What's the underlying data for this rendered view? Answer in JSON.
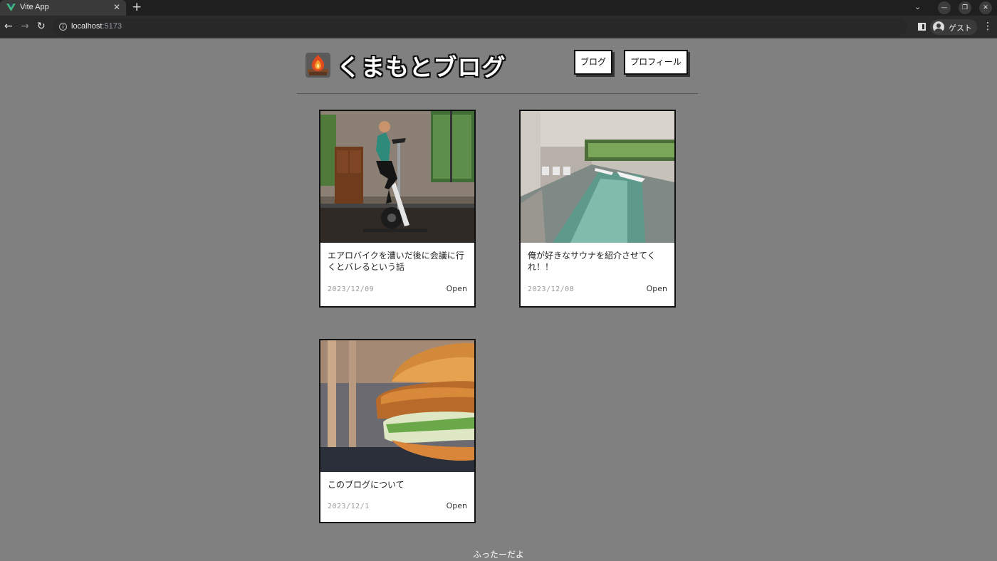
{
  "browser": {
    "tab_title": "Vite App",
    "url_host": "localhost",
    "url_port": ":5173",
    "profile_name": "ゲスト"
  },
  "site": {
    "title": "くまもとブログ",
    "nav": [
      {
        "label": "ブログ"
      },
      {
        "label": "プロフィール"
      }
    ]
  },
  "posts": [
    {
      "title": "エアロバイクを漕いだ後に会議に行くとバレるという話",
      "date": "2023/12/09",
      "open_label": "Open",
      "image": "exercise-bike-photo"
    },
    {
      "title": "俺が好きなサウナを紹介させてくれ！！",
      "date": "2023/12/08",
      "open_label": "Open",
      "image": "indoor-pool-photo"
    },
    {
      "title": "このブログについて",
      "date": "2023/12/1",
      "open_label": "Open",
      "image": "chicken-burger-photo"
    }
  ],
  "footer": {
    "text": "ふったーだよ"
  }
}
